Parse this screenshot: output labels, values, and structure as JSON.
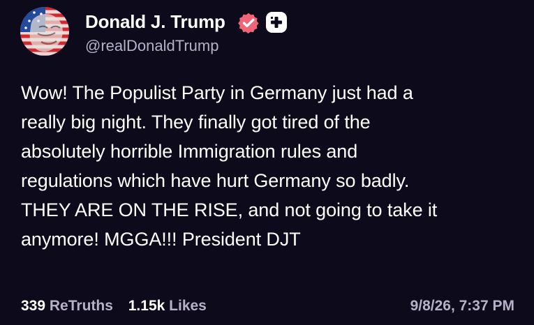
{
  "author": {
    "display_name": "Donald J. Trump",
    "handle": "@realDonaldTrump",
    "avatar_icon": "american-flag-face-avatar",
    "verified_icon": "verified-badge-icon",
    "follow_icon": "plus-icon"
  },
  "post": {
    "lines": [
      "Wow! The Populist Party in Germany just had a",
      "really big night. They finally got tired of the",
      "absolutely horrible Immigration rules and",
      "regulations which have hurt Germany so badly.",
      "THEY ARE ON THE RISE, and not going to take it",
      "anymore! MGGA!!! President DJT"
    ]
  },
  "stats": {
    "retruths_count": "339",
    "retruths_label": "ReTruths",
    "likes_count": "1.15k",
    "likes_label": "Likes"
  },
  "timestamp": "9/8/26, 7:37 PM",
  "colors": {
    "background": "#0d0a1b",
    "primary_text": "#ffffff",
    "secondary_text": "#b6b1c8",
    "verified_badge": "#f26477"
  }
}
